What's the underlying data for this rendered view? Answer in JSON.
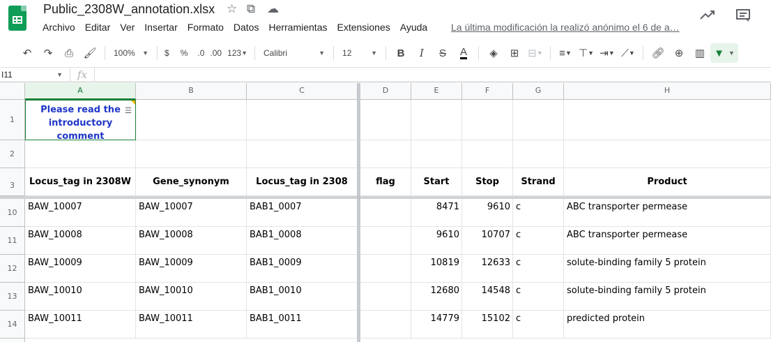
{
  "title": {
    "doc_name": "Public_2308W_annotation.xlsx",
    "last_edit": "La última modificación la realizó anónimo el 6 de a…"
  },
  "menu": [
    "Archivo",
    "Editar",
    "Ver",
    "Insertar",
    "Formato",
    "Datos",
    "Herramientas",
    "Extensiones",
    "Ayuda"
  ],
  "toolbar": {
    "zoom": "100%",
    "currency": "$",
    "percent": "%",
    "dec_decrease": ".0",
    "dec_increase": ".00",
    "more_formats": "123",
    "font": "Calibri",
    "font_size": "12",
    "bold": "B",
    "italic": "I",
    "strike": "S",
    "text_color": "A"
  },
  "formula_bar": {
    "name_box": "I11",
    "fx": "fx",
    "value": ""
  },
  "columns": [
    "A",
    "B",
    "C",
    "D",
    "E",
    "F",
    "G",
    "H"
  ],
  "rows_visible": [
    "1",
    "2",
    "3",
    "10",
    "11",
    "12",
    "13",
    "14"
  ],
  "cells": {
    "a1": "Please read the introductory comment",
    "headers": [
      "Locus_tag in 2308W",
      "Gene_synonym",
      "Locus_tag in 2308",
      "flag",
      "Start",
      "Stop",
      "Strand",
      "Product"
    ]
  },
  "table": [
    {
      "locus_2308w": "BAW_10007",
      "gene_synonym": "BAW_10007",
      "locus_2308": "BAB1_0007",
      "flag": "",
      "start": "8471",
      "stop": "9610",
      "strand": "c",
      "product": "ABC transporter permease"
    },
    {
      "locus_2308w": "BAW_10008",
      "gene_synonym": "BAW_10008",
      "locus_2308": "BAB1_0008",
      "flag": "",
      "start": "9610",
      "stop": "10707",
      "strand": "c",
      "product": "ABC transporter permease"
    },
    {
      "locus_2308w": "BAW_10009",
      "gene_synonym": "BAW_10009",
      "locus_2308": "BAB1_0009",
      "flag": "",
      "start": "10819",
      "stop": "12633",
      "strand": "c",
      "product": "solute-binding family 5 protein"
    },
    {
      "locus_2308w": "BAW_10010",
      "gene_synonym": "BAW_10010",
      "locus_2308": "BAB1_0010",
      "flag": "",
      "start": "12680",
      "stop": "14548",
      "strand": "c",
      "product": "solute-binding family 5 protein"
    },
    {
      "locus_2308w": "BAW_10011",
      "gene_synonym": "BAW_10011",
      "locus_2308": "BAB1_0011",
      "flag": "",
      "start": "14779",
      "stop": "15102",
      "strand": "c",
      "product": "predicted protein"
    }
  ],
  "colors": {
    "brand_green": "#0f9d58",
    "a1_text": "#1f36c7",
    "selection_green": "#188038"
  }
}
